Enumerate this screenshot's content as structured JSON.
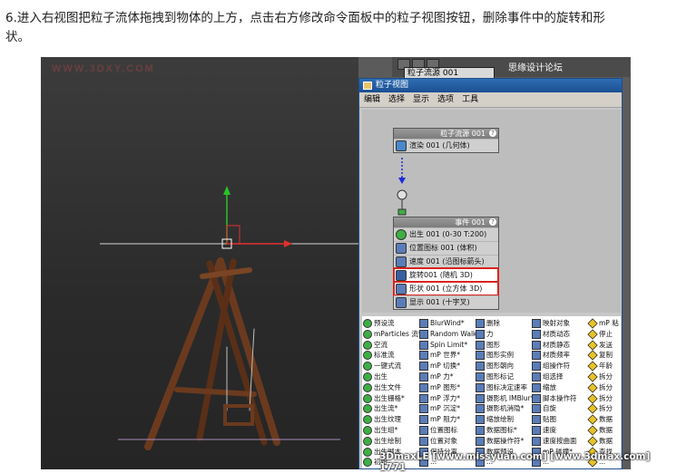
{
  "caption": {
    "line1": "6.进入右视图把粒子流体拖拽到物体的上方，点击右方修改命令面板中的粒子视图按钮，删除事件中的旋转和形",
    "line2": "状。"
  },
  "viewport": {
    "watermark": "WWW.3DXY.COM"
  },
  "command_panel": {
    "field_value": "粒子流源 001",
    "site_mark": "思缘设计论坛"
  },
  "particle_view": {
    "title": "粒子视图",
    "menu": [
      "编辑",
      "选择",
      "显示",
      "选项",
      "工具"
    ],
    "source_node": {
      "header": "粒子流源 001",
      "rows": [
        "渲染 001 (几何体)"
      ]
    },
    "event_node": {
      "header": "事件 001",
      "rows": [
        "出生 001 (0-30 T:200)",
        "位置图标 001 (体积)",
        "速度 001 (沿图标箭头)",
        "旋转001 (随机 3D)",
        "形状 001 (立方体 3D)",
        "显示 001 (十字叉)"
      ]
    },
    "depot": {
      "col1": [
        "预设流",
        "mParticles 流*",
        "空流",
        "标准流",
        "一键式流",
        "出生",
        "出生文件",
        "出生栅格*",
        "出生流*",
        "出生纹理",
        "出生组*",
        "出生绘制",
        "出生脚本",
        "初始..."
      ],
      "col2": [
        "BlurWind*",
        "Random Walk*",
        "Spin Limit*",
        "mP 世界*",
        "mP 切换*",
        "mP 力*",
        "mP 图形*",
        "mP 浮力*",
        "mP 沉淀*",
        "mP 阻力*",
        "位置图标",
        "位置对象",
        "保持分离",
        "..."
      ],
      "col3": [
        "删除",
        "力",
        "图形",
        "图形实例",
        "图形朝向",
        "图形标记",
        "图标决定速率",
        "摄影机 IMBlur*",
        "摄影机消隐*",
        "缩放绘制",
        "数据图标*",
        "数据操作符*",
        "数据预设",
        "..."
      ],
      "col4": [
        "映射对象",
        "材质动态",
        "材质静态",
        "材质频率",
        "组操作符",
        "组选择",
        "缩放",
        "脚本操作符",
        "自旋",
        "贴图",
        "速度",
        "速度按曲面",
        "mP 碰撞*",
        "..."
      ],
      "col5": [
        "mP 粘",
        "停止",
        "发送",
        "复制",
        "年龄",
        "拆分",
        "拆分",
        "拆分",
        "拆分",
        "数据",
        "数据",
        "数据",
        "查找",
        "..."
      ]
    }
  },
  "bottom_watermark": "3DmaxLE [www.missyuan.com] [www.3dmax.com] 1771",
  "colors": {
    "highlight_border": "#d9241f",
    "title_bar": "#1b4f92"
  }
}
